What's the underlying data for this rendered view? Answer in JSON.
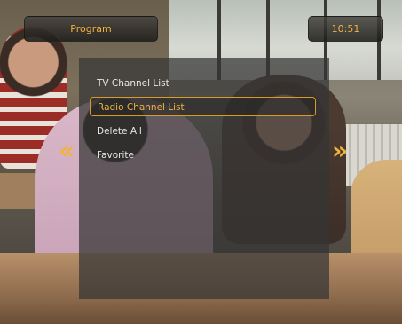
{
  "header": {
    "title": "Program",
    "clock": "10:51"
  },
  "menu": {
    "items": [
      {
        "label": "TV Channel List",
        "selected": false
      },
      {
        "label": "Radio Channel List",
        "selected": true
      },
      {
        "label": "Delete All",
        "selected": false
      },
      {
        "label": "Favorite",
        "selected": false
      }
    ]
  },
  "arrows": {
    "left_icon": "double-chevron-left-icon",
    "right_icon": "double-chevron-right-icon",
    "left_glyph": "«",
    "right_glyph": "»"
  },
  "colors": {
    "accent": "#f3b23c",
    "selection_border": "#d99a2a",
    "panel": "#343434"
  }
}
